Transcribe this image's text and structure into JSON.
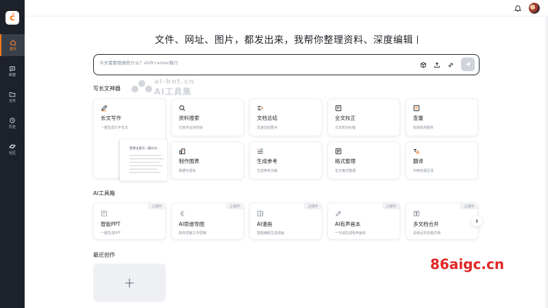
{
  "sidebar": {
    "items": [
      {
        "label": "首页",
        "icon": "home-icon",
        "active": true
      },
      {
        "label": "新建",
        "icon": "new-chat-icon",
        "active": false
      },
      {
        "label": "文件",
        "icon": "folder-icon",
        "active": false
      },
      {
        "label": "历史",
        "icon": "clock-icon",
        "active": false
      },
      {
        "label": "社区",
        "icon": "planet-icon",
        "active": false
      }
    ]
  },
  "header": {
    "headline": "文件、网址、图片，都发出来，我帮你整理资料、深度编辑"
  },
  "search": {
    "placeholder": "今天需要我做些什么？shift+enter换行"
  },
  "watermark": {
    "top": "ai-bot.cn",
    "bottom": "AI工具集"
  },
  "writing_section": {
    "title": "写长文神器",
    "cards": [
      {
        "name": "长文写作",
        "desc": "一键生成万字长文",
        "icon": "pen-icon"
      },
      {
        "name": "资料搜索",
        "desc": "亿级专业资料库",
        "icon": "search-icon"
      },
      {
        "name": "文档总结",
        "desc": "迅速总结要点",
        "icon": "list-icon"
      },
      {
        "name": "全文校正",
        "desc": "文本校对纠错",
        "icon": "proofread-icon"
      },
      {
        "name": "查重",
        "desc": "权威机构服务",
        "icon": "check-doc-icon"
      },
      {
        "name": "制作图表",
        "desc": "数据可视化",
        "icon": "chart-icon"
      },
      {
        "name": "生成参考",
        "desc": "生成参考文献",
        "icon": "reference-icon"
      },
      {
        "name": "格式整理",
        "desc": "论文格式整理",
        "icon": "format-icon"
      },
      {
        "name": "翻译",
        "desc": "中英双语互译",
        "icon": "translate-icon"
      }
    ],
    "preview_title": "帮我主题写一篇长文..."
  },
  "tools_section": {
    "title": "AI工具箱",
    "badge": "上线中",
    "cards": [
      {
        "name": "智能PPT",
        "desc": "一键生成PPT",
        "icon": "ppt-icon"
      },
      {
        "name": "AI思维导图",
        "desc": "助你发散工作思路",
        "icon": "mindmap-icon"
      },
      {
        "name": "AI漫画",
        "desc": "智能辅助生成漫画",
        "icon": "comic-icon"
      },
      {
        "name": "AI有声画本",
        "desc": "一句话生成有声画本",
        "icon": "audio-book-icon"
      },
      {
        "name": "多文档合并",
        "desc": "总结合并多篇文档",
        "icon": "merge-icon"
      }
    ]
  },
  "recent_section": {
    "title": "最近创作",
    "new_label": "+"
  },
  "site_watermark": "86aigc.cn",
  "colors": {
    "accent": "#ff7a1a",
    "sidebar": "#1d2129",
    "watermark": "#e02626"
  }
}
